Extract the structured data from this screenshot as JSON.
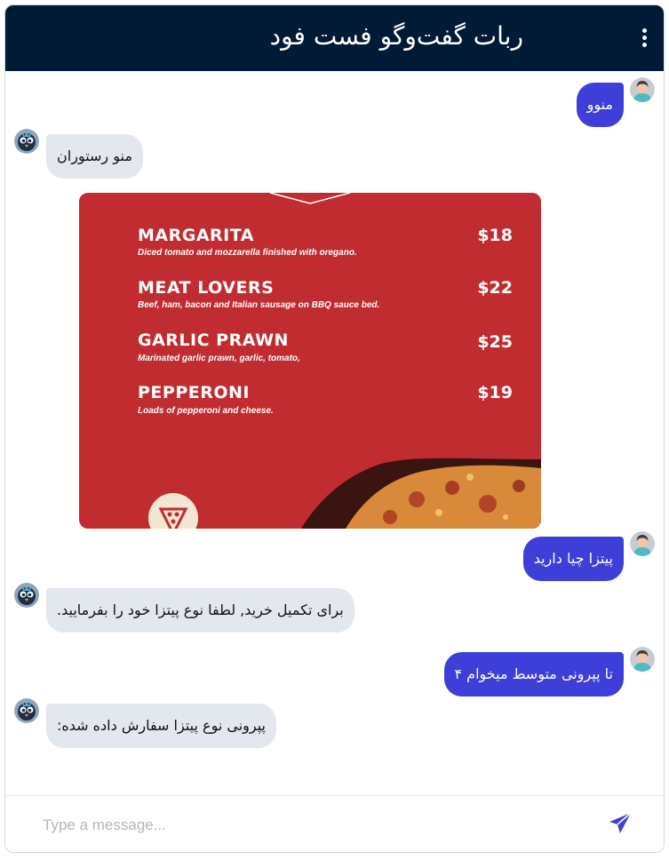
{
  "header": {
    "title": "ربات گفت‌وگو فست فود"
  },
  "messages": [
    {
      "from": "user",
      "text": "منوو"
    },
    {
      "from": "bot",
      "text": "منو رستوران"
    },
    {
      "from": "user",
      "text": "پیتزا چیا دارید"
    },
    {
      "from": "bot",
      "text": "برای تکمیل خرید, لطفا نوع پیتزا خود را بفرمایید."
    },
    {
      "from": "user",
      "text": "تا پپرونی متوسط میخوام ۴"
    },
    {
      "from": "bot",
      "text": "پپرونی نوع پیتزا سفارش داده شده:"
    }
  ],
  "menu_image": {
    "items": [
      {
        "name": "MARGARITA",
        "desc": "Diced tomato and mozzarella finished with oregano.",
        "price": "$18"
      },
      {
        "name": "MEAT LOVERS",
        "desc": "Beef, ham, bacon and Italian sausage on BBQ sauce bed.",
        "price": "$22"
      },
      {
        "name": "GARLIC PRAWN",
        "desc": "Marinated garlic prawn, garlic, tomato,",
        "price": "$25"
      },
      {
        "name": "PEPPERONI",
        "desc": "Loads of pepperoni and cheese.",
        "price": "$19"
      }
    ],
    "colors": {
      "background": "#c12c31",
      "text": "#ffffff"
    }
  },
  "composer": {
    "placeholder": "Type a message..."
  },
  "icons": {
    "menu": "kebab-menu-icon",
    "send": "send-icon",
    "user_avatar": "user-avatar-icon",
    "bot_avatar": "bot-avatar-icon"
  },
  "colors": {
    "header": "#001b35",
    "user_bubble": "#3e3fd8",
    "bot_bubble": "#e3e7ee",
    "accent": "#3e3fd8"
  }
}
